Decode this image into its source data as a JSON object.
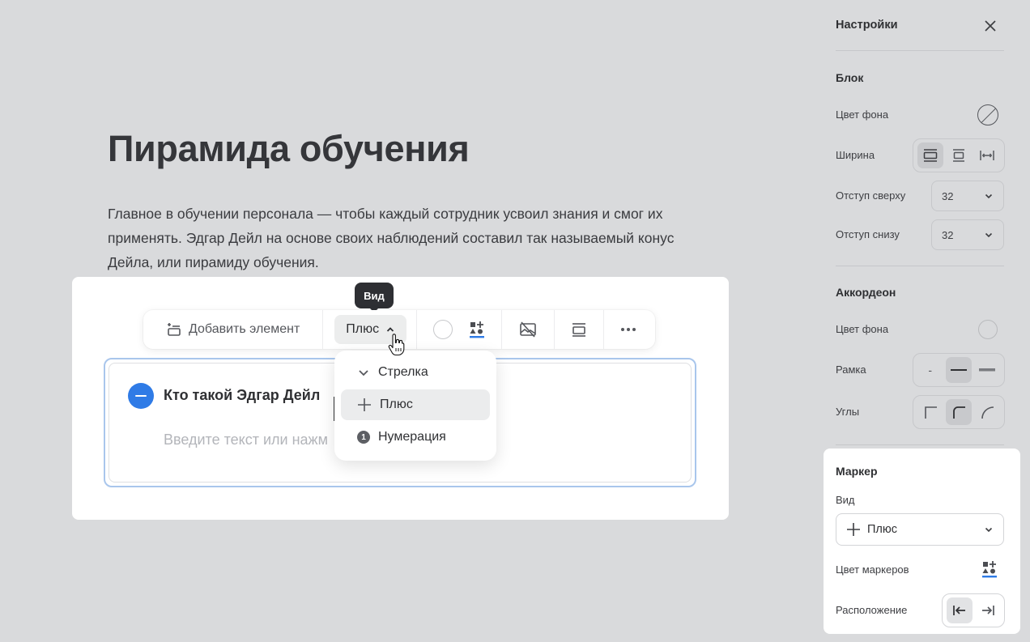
{
  "document": {
    "title": "Пирамида обучения",
    "paragraph": "Главное в обучении персонала — чтобы каждый сотрудник усвоил знания и смог их применять. Эдгар Дейл на основе своих наблюдений составил так называемый конус Дейла, или пирамиду обучения."
  },
  "toolbar": {
    "tooltip": "Вид",
    "add_element": "Добавить элемент",
    "view_value": "Плюс"
  },
  "accordion": {
    "item_title": "Кто такой Эдгар Дейл",
    "placeholder": "Введите текст или нажм"
  },
  "view_menu": {
    "items": [
      {
        "label": "Стрелка",
        "icon": "chevron-down-icon"
      },
      {
        "label": "Плюс",
        "icon": "plus-icon",
        "selected": true
      },
      {
        "label": "Нумерация",
        "icon": "number-badge-icon",
        "badge": "1"
      }
    ]
  },
  "settings": {
    "title": "Настройки",
    "block": {
      "heading": "Блок",
      "bg_color_label": "Цвет фона",
      "width_label": "Ширина",
      "padding_top_label": "Отступ сверху",
      "padding_top_value": "32",
      "padding_bottom_label": "Отступ снизу",
      "padding_bottom_value": "32"
    },
    "accordion": {
      "heading": "Аккордеон",
      "bg_color_label": "Цвет фона",
      "border_label": "Рамка",
      "border_none": "-",
      "corners_label": "Углы"
    },
    "marker": {
      "heading": "Маркер",
      "view_label": "Вид",
      "view_value": "Плюс",
      "color_label": "Цвет маркеров",
      "position_label": "Расположение"
    }
  },
  "colors": {
    "accent": "#2f7be6",
    "selection": "#a9c6ec"
  }
}
